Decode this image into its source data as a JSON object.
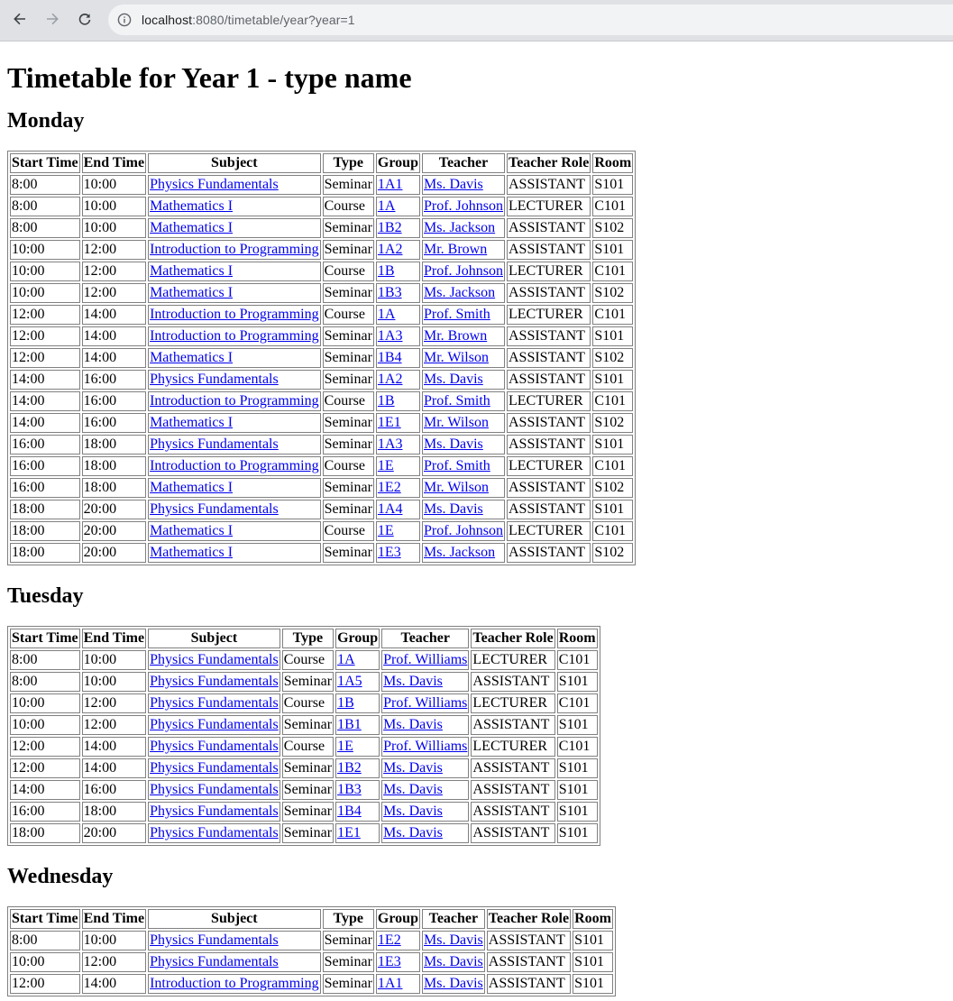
{
  "browser": {
    "url_host": "localhost",
    "url_path": ":8080/timetable/year?year=1"
  },
  "page": {
    "title": "Timetable for Year 1 - type name"
  },
  "headers": [
    "Start Time",
    "End Time",
    "Subject",
    "Type",
    "Group",
    "Teacher",
    "Teacher Role",
    "Room"
  ],
  "days": [
    {
      "name": "Monday",
      "rows": [
        [
          "8:00",
          "10:00",
          "Physics Fundamentals",
          "Seminar",
          "1A1",
          "Ms. Davis",
          "ASSISTANT",
          "S101"
        ],
        [
          "8:00",
          "10:00",
          "Mathematics I",
          "Course",
          "1A",
          "Prof. Johnson",
          "LECTURER",
          "C101"
        ],
        [
          "8:00",
          "10:00",
          "Mathematics I",
          "Seminar",
          "1B2",
          "Ms. Jackson",
          "ASSISTANT",
          "S102"
        ],
        [
          "10:00",
          "12:00",
          "Introduction to Programming",
          "Seminar",
          "1A2",
          "Mr. Brown",
          "ASSISTANT",
          "S101"
        ],
        [
          "10:00",
          "12:00",
          "Mathematics I",
          "Course",
          "1B",
          "Prof. Johnson",
          "LECTURER",
          "C101"
        ],
        [
          "10:00",
          "12:00",
          "Mathematics I",
          "Seminar",
          "1B3",
          "Ms. Jackson",
          "ASSISTANT",
          "S102"
        ],
        [
          "12:00",
          "14:00",
          "Introduction to Programming",
          "Course",
          "1A",
          "Prof. Smith",
          "LECTURER",
          "C101"
        ],
        [
          "12:00",
          "14:00",
          "Introduction to Programming",
          "Seminar",
          "1A3",
          "Mr. Brown",
          "ASSISTANT",
          "S101"
        ],
        [
          "12:00",
          "14:00",
          "Mathematics I",
          "Seminar",
          "1B4",
          "Mr. Wilson",
          "ASSISTANT",
          "S102"
        ],
        [
          "14:00",
          "16:00",
          "Physics Fundamentals",
          "Seminar",
          "1A2",
          "Ms. Davis",
          "ASSISTANT",
          "S101"
        ],
        [
          "14:00",
          "16:00",
          "Introduction to Programming",
          "Course",
          "1B",
          "Prof. Smith",
          "LECTURER",
          "C101"
        ],
        [
          "14:00",
          "16:00",
          "Mathematics I",
          "Seminar",
          "1E1",
          "Mr. Wilson",
          "ASSISTANT",
          "S102"
        ],
        [
          "16:00",
          "18:00",
          "Physics Fundamentals",
          "Seminar",
          "1A3",
          "Ms. Davis",
          "ASSISTANT",
          "S101"
        ],
        [
          "16:00",
          "18:00",
          "Introduction to Programming",
          "Course",
          "1E",
          "Prof. Smith",
          "LECTURER",
          "C101"
        ],
        [
          "16:00",
          "18:00",
          "Mathematics I",
          "Seminar",
          "1E2",
          "Mr. Wilson",
          "ASSISTANT",
          "S102"
        ],
        [
          "18:00",
          "20:00",
          "Physics Fundamentals",
          "Seminar",
          "1A4",
          "Ms. Davis",
          "ASSISTANT",
          "S101"
        ],
        [
          "18:00",
          "20:00",
          "Mathematics I",
          "Course",
          "1E",
          "Prof. Johnson",
          "LECTURER",
          "C101"
        ],
        [
          "18:00",
          "20:00",
          "Mathematics I",
          "Seminar",
          "1E3",
          "Ms. Jackson",
          "ASSISTANT",
          "S102"
        ]
      ]
    },
    {
      "name": "Tuesday",
      "rows": [
        [
          "8:00",
          "10:00",
          "Physics Fundamentals",
          "Course",
          "1A",
          "Prof. Williams",
          "LECTURER",
          "C101"
        ],
        [
          "8:00",
          "10:00",
          "Physics Fundamentals",
          "Seminar",
          "1A5",
          "Ms. Davis",
          "ASSISTANT",
          "S101"
        ],
        [
          "10:00",
          "12:00",
          "Physics Fundamentals",
          "Course",
          "1B",
          "Prof. Williams",
          "LECTURER",
          "C101"
        ],
        [
          "10:00",
          "12:00",
          "Physics Fundamentals",
          "Seminar",
          "1B1",
          "Ms. Davis",
          "ASSISTANT",
          "S101"
        ],
        [
          "12:00",
          "14:00",
          "Physics Fundamentals",
          "Course",
          "1E",
          "Prof. Williams",
          "LECTURER",
          "C101"
        ],
        [
          "12:00",
          "14:00",
          "Physics Fundamentals",
          "Seminar",
          "1B2",
          "Ms. Davis",
          "ASSISTANT",
          "S101"
        ],
        [
          "14:00",
          "16:00",
          "Physics Fundamentals",
          "Seminar",
          "1B3",
          "Ms. Davis",
          "ASSISTANT",
          "S101"
        ],
        [
          "16:00",
          "18:00",
          "Physics Fundamentals",
          "Seminar",
          "1B4",
          "Ms. Davis",
          "ASSISTANT",
          "S101"
        ],
        [
          "18:00",
          "20:00",
          "Physics Fundamentals",
          "Seminar",
          "1E1",
          "Ms. Davis",
          "ASSISTANT",
          "S101"
        ]
      ]
    },
    {
      "name": "Wednesday",
      "rows": [
        [
          "8:00",
          "10:00",
          "Physics Fundamentals",
          "Seminar",
          "1E2",
          "Ms. Davis",
          "ASSISTANT",
          "S101"
        ],
        [
          "10:00",
          "12:00",
          "Physics Fundamentals",
          "Seminar",
          "1E3",
          "Ms. Davis",
          "ASSISTANT",
          "S101"
        ],
        [
          "12:00",
          "14:00",
          "Introduction to Programming",
          "Seminar",
          "1A1",
          "Ms. Davis",
          "ASSISTANT",
          "S101"
        ]
      ]
    }
  ]
}
